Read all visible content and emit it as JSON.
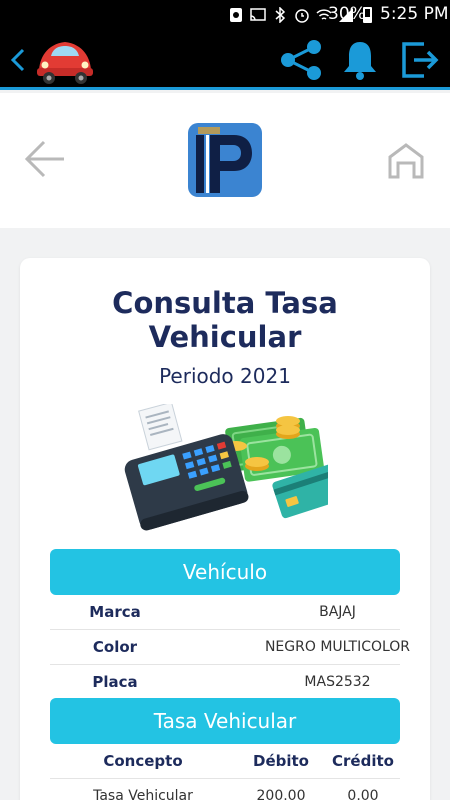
{
  "status_bar": {
    "battery_percent": "30%",
    "time": "5:25 PM"
  },
  "app_bar": {
    "icons": [
      "back-chevron-icon",
      "car-logo",
      "share-icon",
      "bell-icon",
      "exit-icon"
    ],
    "accent_color": "#1b9ad8"
  },
  "header": {
    "icons": [
      "back-arrow-icon",
      "ip-logo",
      "home-icon"
    ]
  },
  "card": {
    "title_line1": "Consulta Tasa",
    "title_line2": "Vehicular",
    "subtitle": "Periodo 2021",
    "vehicle_section": {
      "heading": "Vehículo",
      "rows": [
        {
          "label": "Marca",
          "value": "BAJAJ"
        },
        {
          "label": "Color",
          "value": "NEGRO MULTICOLOR"
        },
        {
          "label": "Placa",
          "value": "MAS2532"
        }
      ]
    },
    "tax_section": {
      "heading": "Tasa Vehicular",
      "columns": [
        "Concepto",
        "Débito",
        "Crédito"
      ],
      "rows": [
        {
          "concepto": "Tasa Vehicular",
          "debito": "200.00",
          "credito": "0.00"
        }
      ]
    }
  },
  "colors": {
    "band": "#23c3e3",
    "title": "#1d2b5c",
    "background": "#f1f2f3"
  }
}
